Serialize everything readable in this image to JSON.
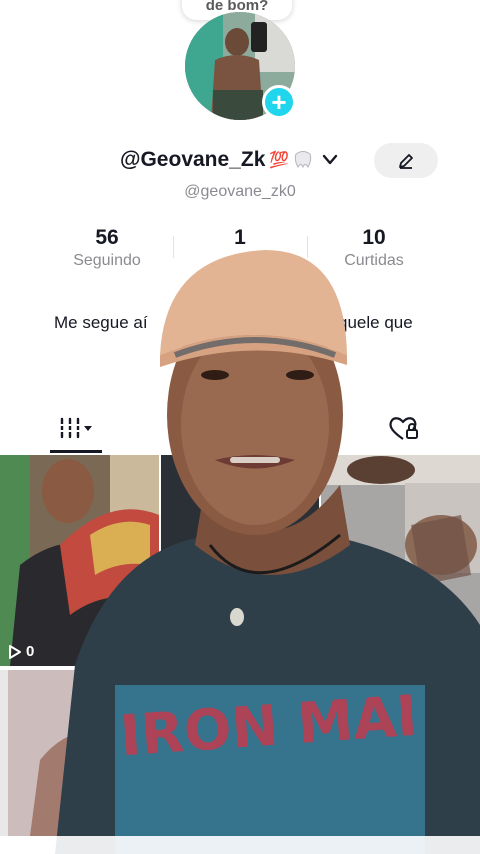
{
  "profile": {
    "bubble_text": "de bom?",
    "username": "@Geovane_Zk",
    "username_emoji": "💯",
    "handle": "@geovane_zk0",
    "bio_left": "Me segue aí",
    "bio_right": "quele que"
  },
  "stats": [
    {
      "value": "56",
      "label": "Seguindo"
    },
    {
      "value": "1",
      "label": ""
    },
    {
      "value": "10",
      "label": "Curtidas"
    }
  ],
  "grid": {
    "first_views": "0"
  },
  "icons": {
    "add": "plus-icon",
    "dropdown": "chevron-down-icon",
    "edit": "pencil-icon",
    "videos_tab": "grid-icon",
    "liked_tab": "heart-lock-icon",
    "play": "play-icon"
  },
  "colors": {
    "accent_cyan": "#20d5ec",
    "text_primary": "#161823",
    "text_secondary": "#8a8b91"
  }
}
